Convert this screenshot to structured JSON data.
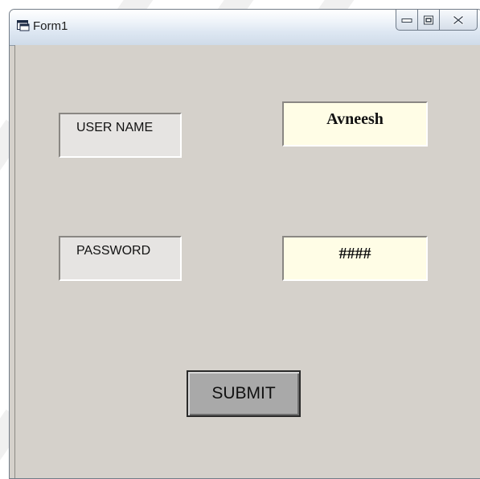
{
  "window": {
    "title": "Form1",
    "icon": "form-window-icon",
    "caption_buttons": [
      "minimize-icon",
      "maximize-icon",
      "close-icon"
    ]
  },
  "form": {
    "username_label": "USER NAME",
    "username_value": "Avneesh",
    "password_label": "PASSWORD",
    "password_value": "####",
    "submit_label": "SUBMIT"
  },
  "colors": {
    "form_background": "#d5d1cb",
    "textbox_background": "#fffde6",
    "label_background": "#e6e4e2",
    "button_background": "#a9a9a9"
  }
}
